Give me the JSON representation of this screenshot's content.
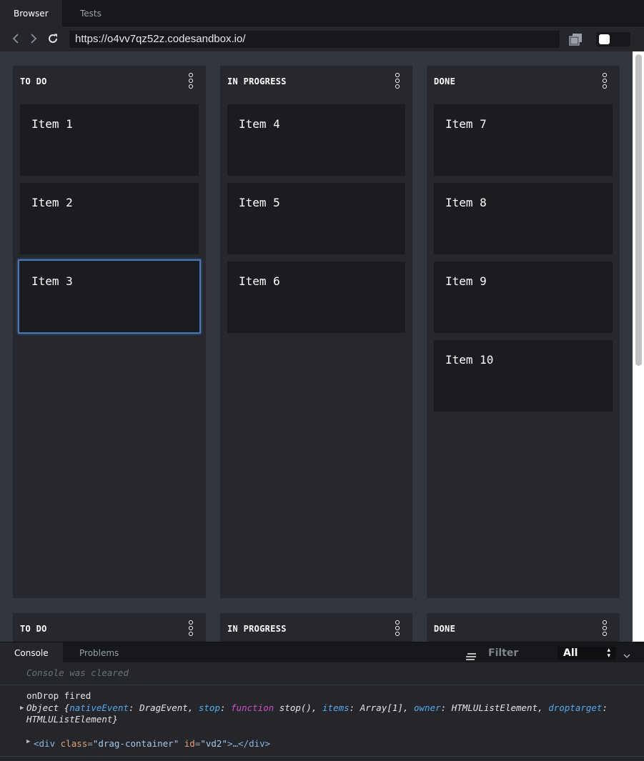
{
  "tabs": [
    {
      "label": "Browser"
    },
    {
      "label": "Tests"
    }
  ],
  "toolbar": {
    "url": "https://o4vv7qz52z.codesandbox.io/"
  },
  "board": {
    "columns": [
      {
        "title": "TO DO",
        "cards": [
          "Item 1",
          "Item 2",
          "Item 3"
        ],
        "selected_card": "Item 3"
      },
      {
        "title": "IN PROGRESS",
        "cards": [
          "Item 4",
          "Item 5",
          "Item 6"
        ]
      },
      {
        "title": "DONE",
        "cards": [
          "Item 7",
          "Item 8",
          "Item 9",
          "Item 10"
        ]
      }
    ],
    "second_row_titles": [
      "TO DO",
      "IN PROGRESS",
      "DONE"
    ]
  },
  "console": {
    "tabs": [
      {
        "label": "Console"
      },
      {
        "label": "Problems"
      }
    ],
    "filter_label": "Filter",
    "level": "All",
    "cleared_message": "Console was cleared",
    "log_message": "onDrop fired",
    "object_log": {
      "prefix": "Object {",
      "entries": [
        {
          "key": "nativeEvent",
          "value": "DragEvent"
        },
        {
          "key": "stop",
          "value": "function stop()"
        },
        {
          "key": "items",
          "value": "Array[1]"
        },
        {
          "key": "owner",
          "value": "HTMLUListElement"
        },
        {
          "key": "droptarget",
          "value": "HTMLUListElement"
        }
      ],
      "suffix": "}"
    },
    "element_log": {
      "tag_open": "<div",
      "attr1_name": "class",
      "attr1_value": "\"drag-container\"",
      "attr2_name": "id",
      "attr2_value": "\"vd2\"",
      "rest": ">…</div>"
    }
  },
  "colors": {
    "accent_selection": "#4a76b8",
    "board_background": "#34363d",
    "column_background": "#26282e",
    "card_background": "#1b1c20"
  }
}
